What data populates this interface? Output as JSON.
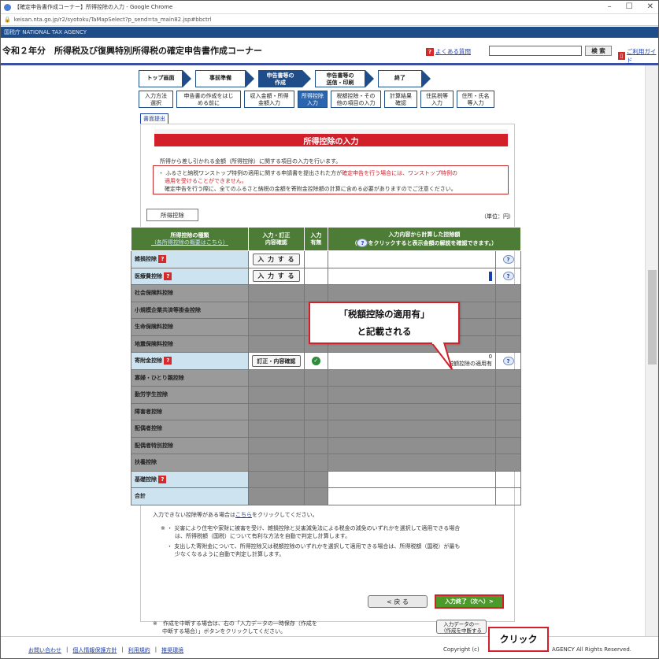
{
  "browser": {
    "window_title": "【確定申告書作成コーナー】所得控除の入力 - Google Chrome",
    "url": "keisan.nta.go.jp/r2/syotoku/TaMapSelect?p_send=ta_main82.jsp#bbctrl",
    "controls": [
      "–",
      "☐",
      "✕"
    ]
  },
  "agency_bar": "国税庁 NATIONAL TAX AGENCY",
  "header": {
    "title": "令和２年分　所得税及び復興特別所得税の確定申告書作成コーナー",
    "faq": "よくある質問",
    "search_button": "検 索",
    "guide": "ご利用ガイド"
  },
  "steps": [
    {
      "label": "トップ画面",
      "current": false
    },
    {
      "label": "事前準備",
      "current": false
    },
    {
      "label": "申告書等の\n作成",
      "current": true
    },
    {
      "label": "申告書等の\n送信・印刷",
      "current": false
    },
    {
      "label": "終了",
      "current": false
    }
  ],
  "substeps": [
    {
      "label": "入力方法\n選択",
      "w": 44,
      "state": "done"
    },
    {
      "label": "申告書の作成をはじ\nめる前に",
      "w": 82,
      "state": "done"
    },
    {
      "label": "収入金額・所得\n金額入力",
      "w": 64,
      "state": "done"
    },
    {
      "label": "所得控除\n入力",
      "w": 38,
      "state": "cur"
    },
    {
      "label": "税額控除・その\n他の項目の入力",
      "w": 64,
      "state": "todo"
    },
    {
      "label": "計算結果\n確認",
      "w": 42,
      "state": "todo"
    },
    {
      "label": "住民税等\n入力",
      "w": 42,
      "state": "todo"
    },
    {
      "label": "住所・氏名\n等入力",
      "w": 48,
      "state": "todo"
    }
  ],
  "submit_link": "書面提出",
  "page_title": "所得控除の入力",
  "intro": "所得から差し引かれる金額（所得控除）に関する項目の入力を行います。",
  "notice": {
    "line1a": "・ ふるさと納税ワンストップ特例の適用に関する申請書を提出された方が",
    "line1b": "確定申告を行う場合には、ワンストップ特例の",
    "line2": "適用を受けることができません。",
    "line3": "確定申告を行う際に、全てのふるさと納税の金額を寄附金控除額の計算に含める必要がありますのでご注意ください。"
  },
  "tab_label": "所得控除",
  "unit": "（単位：円）",
  "table": {
    "headers": {
      "kind": "所得控除の種類",
      "kind_link": "（各所得控除の概要はこちら）",
      "input": "入力・訂正\n内容確認",
      "has": "入力\n有無",
      "amount": "入力内容から計算した控除額\n（",
      "amount_tail": "をクリックすると表示金額の解説を確認できます。）"
    },
    "input_button": "入 力 す る",
    "edit_button": "訂正・内容確認",
    "rows": [
      {
        "name": "雑損控除",
        "q": true,
        "type": "input"
      },
      {
        "name": "医療費控除",
        "q": true,
        "type": "input"
      },
      {
        "name": "社会保険料控除",
        "q": false,
        "type": "gray"
      },
      {
        "name": "小規模企業共済等掛金控除",
        "q": false,
        "type": "gray"
      },
      {
        "name": "生命保険料控除",
        "q": false,
        "type": "gray"
      },
      {
        "name": "地震保険料控除",
        "q": false,
        "type": "gray"
      },
      {
        "name": "寄附金控除",
        "q": true,
        "type": "edit",
        "value": "0",
        "note": "税額控除の適用有"
      },
      {
        "name": "寡婦・ひとり親控除",
        "q": false,
        "type": "gray"
      },
      {
        "name": "勤労学生控除",
        "q": false,
        "type": "gray"
      },
      {
        "name": "障害者控除",
        "q": false,
        "type": "gray"
      },
      {
        "name": "配偶者控除",
        "q": false,
        "type": "gray"
      },
      {
        "name": "配偶者特別控除",
        "q": false,
        "type": "gray"
      },
      {
        "name": "扶養控除",
        "q": false,
        "type": "gray"
      },
      {
        "name": "基礎控除",
        "q": true,
        "type": "blank"
      },
      {
        "name": "合計",
        "q": false,
        "type": "blank"
      }
    ]
  },
  "callout": {
    "line1": "「税額控除の適用有」",
    "line2": "と記載される"
  },
  "footnote": {
    "prefix": "入力できない控除等がある場合は",
    "link": "こちら",
    "suffix": "をクリックしてください。"
  },
  "bullets": [
    "※ ・ 災害により住宅や家財に被害を受け、雑損控除と災害減免法による税金の減免のいずれかを選択して適用できる場合",
    "は、所得税額（国税）について有利な方法を自動で判定し計算します。",
    "・ 支出した寄附金について、所得控除又は税額控除のいずれかを選択して適用できる場合は、所得税額（国税）が最も",
    "少なくなるように自動で判定し計算します。"
  ],
  "back_button": "< 戻 る",
  "next_button": "入力終了（次へ）>",
  "interrupt": {
    "line1": "※　作成を中断する場合は、右の「入力データの一時保存（作成を",
    "line2": "中断する場合）」ボタンをクリックしてください。"
  },
  "save_button": "入力データの一\n（作成を中断する",
  "click_label": "クリック",
  "footer": {
    "links": [
      "お問い合わせ",
      "個人情報保護方針",
      "利用規約",
      "推奨環境"
    ],
    "copyright": "Copyright (c)",
    "copyright_tail": "AGENCY All Rights Reserved."
  }
}
